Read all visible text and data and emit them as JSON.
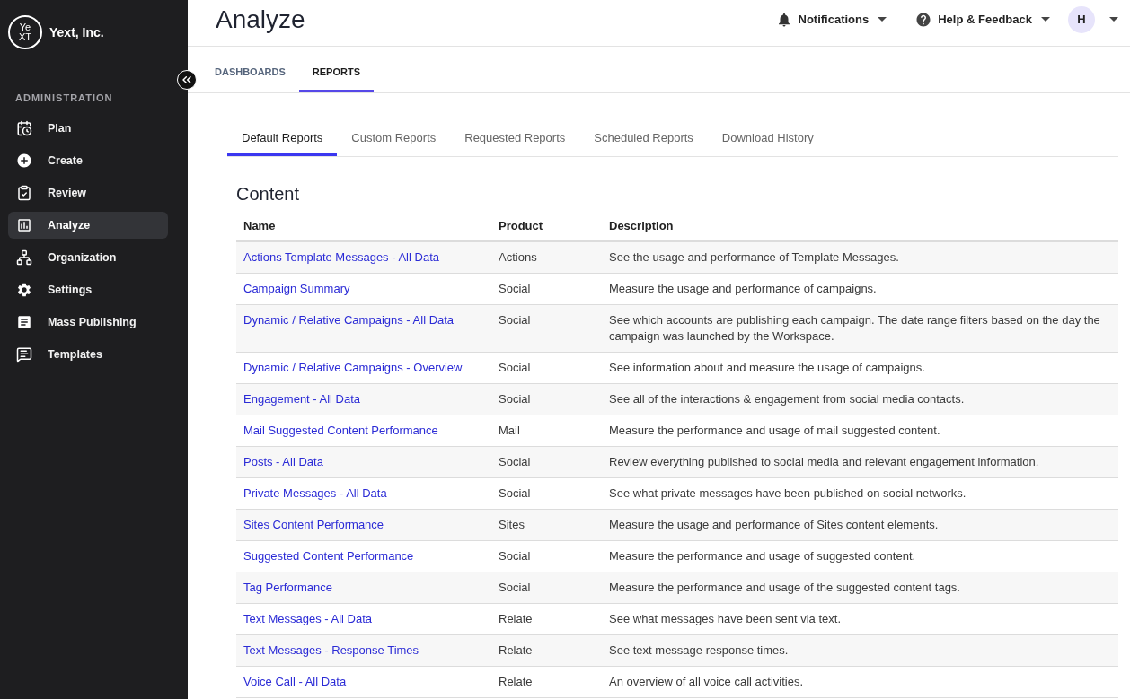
{
  "sidebar": {
    "logo": [
      "Ye",
      "XT"
    ],
    "org_name": "Yext, Inc.",
    "section_label": "ADMINISTRATION",
    "items": [
      {
        "label": "Plan",
        "selected": false
      },
      {
        "label": "Create",
        "selected": false
      },
      {
        "label": "Review",
        "selected": false
      },
      {
        "label": "Analyze",
        "selected": true
      },
      {
        "label": "Organization",
        "selected": false
      },
      {
        "label": "Settings",
        "selected": false
      },
      {
        "label": "Mass Publishing",
        "selected": false
      },
      {
        "label": "Templates",
        "selected": false
      }
    ]
  },
  "header": {
    "title": "Analyze",
    "notifications": "Notifications",
    "help": "Help & Feedback",
    "avatar": "H"
  },
  "tabs": [
    {
      "label": "DASHBOARDS",
      "selected": false
    },
    {
      "label": "REPORTS",
      "selected": true
    }
  ],
  "subtabs": [
    {
      "label": "Default Reports",
      "selected": true
    },
    {
      "label": "Custom Reports",
      "selected": false
    },
    {
      "label": "Requested Reports",
      "selected": false
    },
    {
      "label": "Scheduled Reports",
      "selected": false
    },
    {
      "label": "Download History",
      "selected": false
    }
  ],
  "section_title": "Content",
  "table": {
    "columns": [
      "Name",
      "Product",
      "Description"
    ],
    "rows": [
      {
        "name": "Actions Template Messages - All Data",
        "product": "Actions",
        "description": "See the usage and performance of Template Messages."
      },
      {
        "name": "Campaign Summary",
        "product": "Social",
        "description": "Measure the usage and performance of campaigns."
      },
      {
        "name": "Dynamic / Relative Campaigns - All Data",
        "product": "Social",
        "description": "See which accounts are publishing each campaign. The date range filters based on the day the campaign was launched by the Workspace."
      },
      {
        "name": "Dynamic / Relative Campaigns - Overview",
        "product": "Social",
        "description": "See information about and measure the usage of campaigns."
      },
      {
        "name": "Engagement - All Data",
        "product": "Social",
        "description": "See all of the interactions & engagement from social media contacts."
      },
      {
        "name": "Mail Suggested Content Performance",
        "product": "Mail",
        "description": "Measure the performance and usage of mail suggested content."
      },
      {
        "name": "Posts - All Data",
        "product": "Social",
        "description": "Review everything published to social media and relevant engagement information."
      },
      {
        "name": "Private Messages - All Data",
        "product": "Social",
        "description": "See what private messages have been published on social networks."
      },
      {
        "name": "Sites Content Performance",
        "product": "Sites",
        "description": "Measure the usage and performance of Sites content elements."
      },
      {
        "name": "Suggested Content Performance",
        "product": "Social",
        "description": "Measure the performance and usage of suggested content."
      },
      {
        "name": "Tag Performance",
        "product": "Social",
        "description": "Measure the performance and usage of the suggested content tags."
      },
      {
        "name": "Text Messages - All Data",
        "product": "Relate",
        "description": "See what messages have been sent via text."
      },
      {
        "name": "Text Messages - Response Times",
        "product": "Relate",
        "description": "See text message response times."
      },
      {
        "name": "Voice Call - All Data",
        "product": "Relate",
        "description": "An overview of all voice call activities."
      }
    ]
  }
}
